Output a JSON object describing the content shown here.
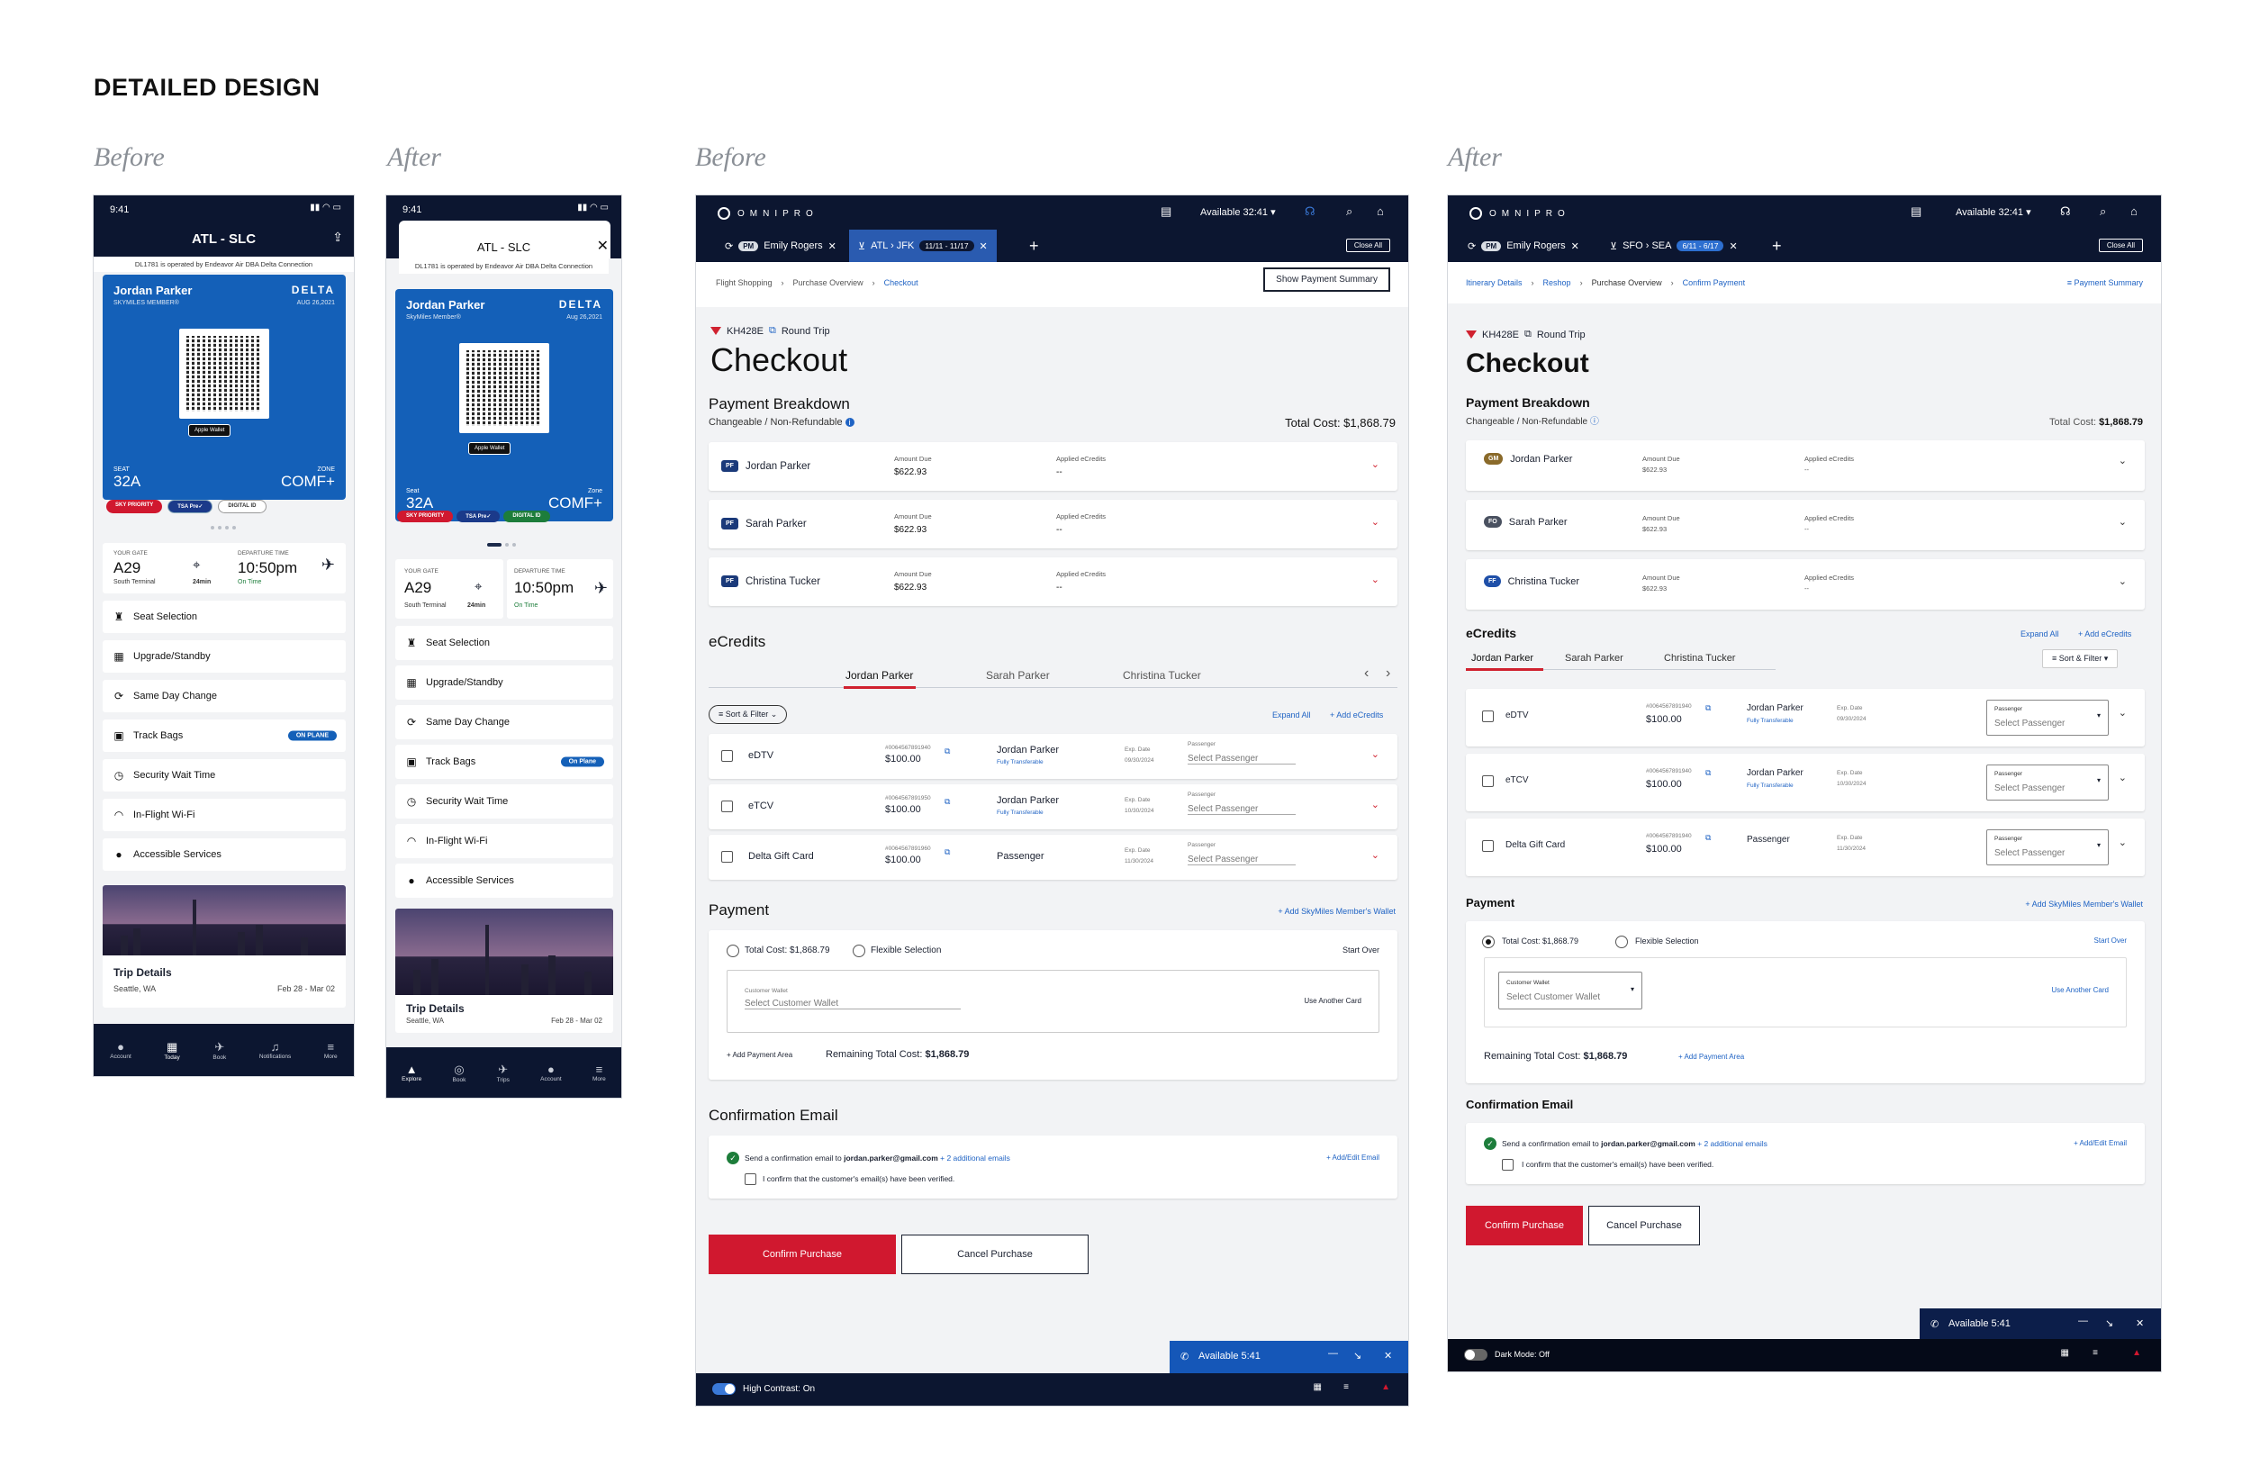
{
  "page_title": "DETAILED DESIGN",
  "labels": {
    "before1": "Before",
    "after1": "After",
    "before2": "Before",
    "after2": "After"
  },
  "colors": {
    "navy": "#0c1630",
    "delta_blue": "#1460b8",
    "red": "#d0182f",
    "link": "#1f63c4"
  },
  "phone_before": {
    "time": "9:41",
    "route": "ATL - SLC",
    "operated": "DL1781 is operated by Endeavor Air DBA Delta Connection",
    "name": "Jordan Parker",
    "member": "SKYMILES MEMBER®",
    "airline": "DELTA",
    "date": "AUG 26,2021",
    "apple_wallet": "Apple Wallet",
    "seat_k": "SEAT",
    "seat_v": "32A",
    "zone_k": "ZONE",
    "zone_v": "COMF+",
    "pills": [
      "SKY PRIORITY",
      "TSA Pre✓",
      "DIGITAL ID"
    ],
    "gate_k": "YOUR GATE",
    "gate_v": "A29",
    "gate_s": "South Terminal",
    "walk": "24min",
    "dep_k": "DEPARTURE TIME",
    "dep_v": "10:50pm",
    "dep_s": "On Time",
    "menu": [
      "Seat Selection",
      "Upgrade/Standby",
      "Same Day Change",
      "Track Bags",
      "Security Wait Time",
      "In-Flight Wi-Fi",
      "Accessible Services"
    ],
    "badge": "ON PLANE",
    "trip_title": "Trip Details",
    "trip_loc": "Seattle, WA",
    "trip_dates": "Feb 28 - Mar 02",
    "tabs": [
      "Account",
      "Today",
      "Book",
      "Notifications",
      "More"
    ]
  },
  "phone_after": {
    "time": "9:41",
    "route": "ATL - SLC",
    "operated": "DL1781 is operated by Endeavor Air DBA Delta Connection",
    "name": "Jordan Parker",
    "member": "SkyMiles Member®",
    "airline": "DELTA",
    "date": "Aug 26,2021",
    "apple_wallet": "Apple Wallet",
    "seat_k": "Seat",
    "seat_v": "32A",
    "zone_k": "Zone",
    "zone_v": "COMF+",
    "pills": [
      "SKY PRIORITY",
      "TSA Pre✓",
      "DIGITAL ID"
    ],
    "gate_k": "YOUR GATE",
    "gate_v": "A29",
    "gate_s": "South Terminal",
    "walk": "24min",
    "dep_k": "DEPARTURE TIME",
    "dep_v": "10:50pm",
    "dep_s": "On Time",
    "menu": [
      "Seat Selection",
      "Upgrade/Standby",
      "Same Day Change",
      "Track Bags",
      "Security Wait Time",
      "In-Flight Wi-Fi",
      "Accessible Services"
    ],
    "badge": "On Plane",
    "trip_title": "Trip Details",
    "trip_loc": "Seattle, WA",
    "trip_dates": "Feb 28 - Mar 02",
    "tabs": [
      "Explore",
      "Book",
      "Trips",
      "Account",
      "More"
    ]
  },
  "desk_before": {
    "logo": "OMNIPRO",
    "available": "Available 32:41 ▾",
    "tab1_pm": "PM",
    "tab1": "Emily Rogers",
    "tab2": "ATL › JFK",
    "tab2_rt": "11/11 - 11/17",
    "close_all": "Close All",
    "breadcrumb": [
      "Flight Shopping",
      "Purchase Overview",
      "Checkout"
    ],
    "payment_summary": "Show Payment Summary",
    "flight": "KH428E",
    "trip_type": "Round Trip",
    "heading": "Checkout",
    "pb_title": "Payment Breakdown",
    "pb_sub": "Changeable / Non-Refundable",
    "total": "Total Cost: $1,868.79",
    "passengers": [
      {
        "ini": "PF",
        "name": "Jordan Parker"
      },
      {
        "ini": "PF",
        "name": "Sarah Parker"
      },
      {
        "ini": "PF",
        "name": "Christina Tucker"
      }
    ],
    "amount_k": "Amount Due",
    "amount_v": "$622.93",
    "applied_k": "Applied eCredits",
    "applied_v": "--",
    "ec_title": "eCredits",
    "ec_tabs": [
      "Jordan Parker",
      "Sarah Parker",
      "Christina Tucker"
    ],
    "sort": "Sort & Filter",
    "expand": "Expand All",
    "add_ec": "+ Add eCredits",
    "credits": [
      {
        "name": "eDTV",
        "num": "#0064567891940",
        "amt": "$100.00",
        "pax": "Jordan Parker",
        "ft": "Fully Transferable",
        "exp_k": "Exp. Date",
        "exp": "09/30/2024",
        "pk": "Passenger",
        "sel": "Select Passenger"
      },
      {
        "name": "eTCV",
        "num": "#0064567891950",
        "amt": "$100.00",
        "pax": "Jordan Parker",
        "ft": "Fully Transferable",
        "exp_k": "Exp. Date",
        "exp": "10/30/2024",
        "pk": "Passenger",
        "sel": "Select Passenger"
      },
      {
        "name": "Delta Gift Card",
        "num": "#0064567891960",
        "amt": "$100.00",
        "pax": "Passenger",
        "ft": "",
        "exp_k": "Exp. Date",
        "exp": "11/30/2024",
        "pk": "Passenger",
        "sel": "Select Passenger"
      }
    ],
    "pay_title": "Payment",
    "add_wallet": "+ Add SkyMiles Member's Wallet",
    "r_total": "Total Cost: $1,868.79",
    "r_flex": "Flexible Selection",
    "start_over": "Start Over",
    "wallet_k": "Customer Wallet",
    "wallet_v": "Select Customer Wallet",
    "another": "Use Another Card",
    "add_area": "+ Add Payment Area",
    "remaining": "Remaining Total Cost:",
    "remaining_v": "$1,868.79",
    "ce_title": "Confirmation Email",
    "ce_send": "Send a confirmation email to",
    "ce_email": "jordan.parker@gmail.com",
    "ce_more": "+ 2 additional emails",
    "ce_edit": "+ Add/Edit Email",
    "ce_confirm": "I confirm that the customer's email(s) have been verified.",
    "confirm": "Confirm Purchase",
    "cancel": "Cancel Purchase",
    "avail_bar": "Available 5:41",
    "contrast": "High Contrast: On"
  },
  "desk_after": {
    "logo": "OMNIPRO",
    "available": "Available 32:41 ▾",
    "tab1_pm": "PM",
    "tab1": "Emily Rogers",
    "tab2": "SFO › SEA",
    "tab2_rt": "6/11 - 6/17",
    "close_all": "Close All",
    "breadcrumb": [
      "Itinerary Details",
      "Reshop",
      "Purchase Overview",
      "Confirm Payment"
    ],
    "payment_summary": "Payment Summary",
    "flight": "KH428E",
    "trip_type": "Round Trip",
    "heading": "Checkout",
    "pb_title": "Payment Breakdown",
    "pb_sub": "Changeable / Non-Refundable",
    "total_k": "Total Cost:",
    "total_v": "$1,868.79",
    "passengers": [
      {
        "ini": "GM",
        "name": "Jordan Parker"
      },
      {
        "ini": "FO",
        "name": "Sarah Parker"
      },
      {
        "ini": "FF",
        "name": "Christina Tucker"
      }
    ],
    "amount_k": "Amount Due",
    "amount_v": "$622.93",
    "applied_k": "Applied eCredits",
    "applied_v": "--",
    "ec_title": "eCredits",
    "ec_tabs": [
      "Jordan Parker",
      "Sarah Parker",
      "Christina Tucker"
    ],
    "sort": "Sort & Filter",
    "expand": "Expand All",
    "add_ec": "+ Add eCredits",
    "credits": [
      {
        "name": "eDTV",
        "num": "#0064567891940",
        "amt": "$100.00",
        "pax": "Jordan Parker",
        "ft": "Fully Transferable",
        "exp_k": "Exp. Date",
        "exp": "09/30/2024",
        "pk": "Passenger",
        "sel": "Select Passenger"
      },
      {
        "name": "eTCV",
        "num": "#0064567891940",
        "amt": "$100.00",
        "pax": "Jordan Parker",
        "ft": "Fully Transferable",
        "exp_k": "Exp. Date",
        "exp": "10/30/2024",
        "pk": "Passenger",
        "sel": "Select Passenger"
      },
      {
        "name": "Delta Gift Card",
        "num": "#0064567891940",
        "amt": "$100.00",
        "pax": "Passenger",
        "ft": "",
        "exp_k": "Exp. Date",
        "exp": "11/30/2024",
        "pk": "Passenger",
        "sel": "Select Passenger"
      }
    ],
    "pay_title": "Payment",
    "add_wallet": "+ Add SkyMiles Member's Wallet",
    "r_total": "Total Cost: $1,868.79",
    "r_flex": "Flexible Selection",
    "start_over": "Start Over",
    "wallet_k": "Customer Wallet",
    "wallet_v": "Select Customer Wallet",
    "another": "Use Another Card",
    "remaining": "Remaining Total Cost:",
    "remaining_v": "$1,868.79",
    "add_area": "+ Add Payment Area",
    "ce_title": "Confirmation Email",
    "ce_send": "Send a confirmation email to",
    "ce_email": "jordan.parker@gmail.com",
    "ce_more": "+ 2 additional emails",
    "ce_edit": "+ Add/Edit Email",
    "ce_confirm": "I confirm that the customer's email(s) have been verified.",
    "confirm": "Confirm Purchase",
    "cancel": "Cancel Purchase",
    "avail_bar": "Available 5:41",
    "dark": "Dark Mode: Off"
  }
}
